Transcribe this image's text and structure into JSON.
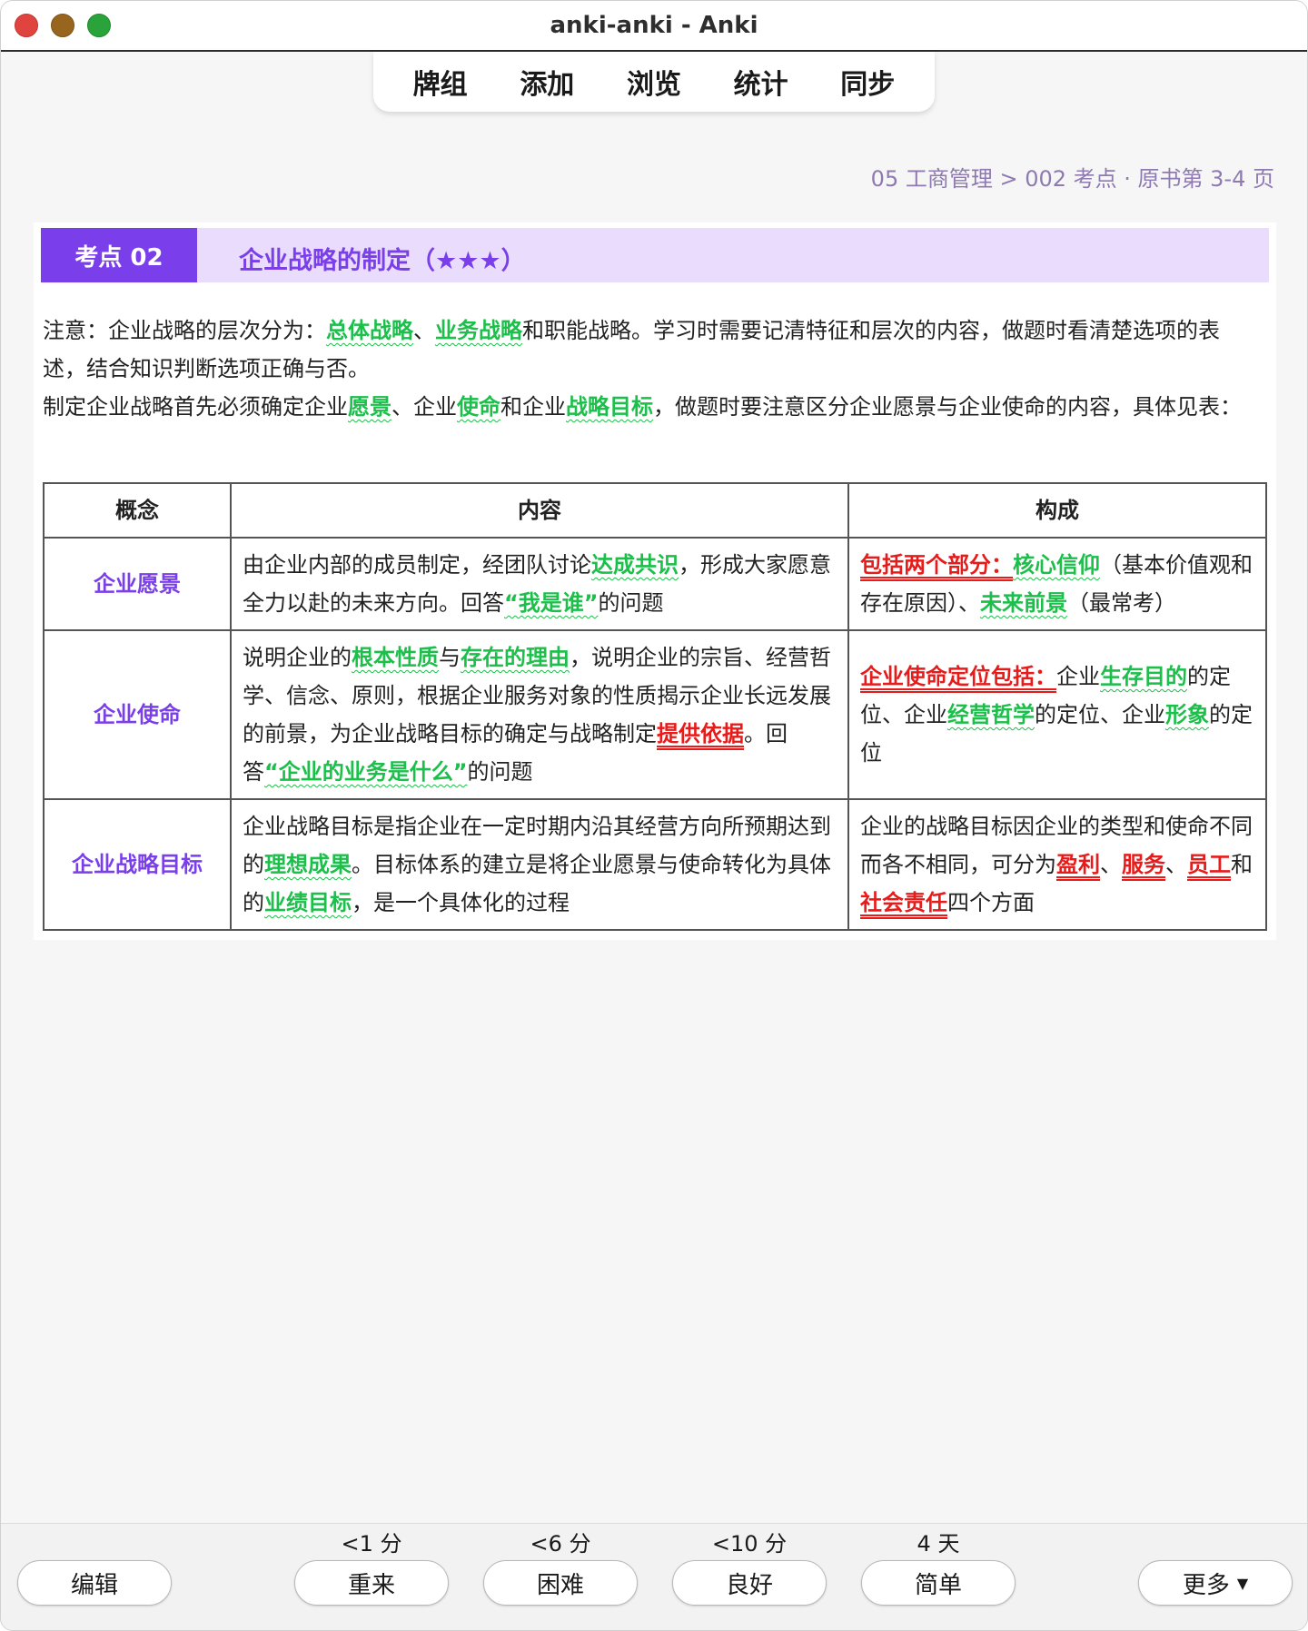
{
  "window": {
    "title": "anki-anki - Anki"
  },
  "toolbar": {
    "items": [
      "牌组",
      "添加",
      "浏览",
      "统计",
      "同步"
    ]
  },
  "breadcrumb": "05 工商管理 > 002 考点 · 原书第 3-4 页",
  "card": {
    "badge": "考点  02",
    "heading": "企业战略的制定（★★★）",
    "para1": {
      "t1": "注意：企业战略的层次分为：",
      "h1": "总体战略",
      "t2": "、",
      "h2": "业务战略",
      "t3": "和职能战略。学习时需要记清特征和层次的内容，做题时看清楚选项的表述，结合知识判断选项正确与否。"
    },
    "para2": {
      "t1": "制定企业战略首先必须确定企业",
      "h1": "愿景",
      "t2": "、企业",
      "h2": "使命",
      "t3": "和企业",
      "h3": "战略目标",
      "t4": "，做题时要注意区分企业愿景与企业使命的内容，具体见表："
    },
    "table": {
      "headers": [
        "概念",
        "内容",
        "构成"
      ],
      "rows": [
        {
          "term": "企业愿景",
          "content": {
            "t1": "由企业内部的成员制定，经团队讨论",
            "h1": "达成共识",
            "t2": "，形成大家愿意全力以赴的未来方向。回答",
            "h2": "“我是谁”",
            "t3": "的问题"
          },
          "comp": {
            "r1": "包括两个部分：",
            "h1": "核心信仰",
            "t1": "（基本价值观和存在原因）、",
            "h2": "未来前景",
            "t2": "（最常考）"
          }
        },
        {
          "term": "企业使命",
          "content": {
            "t1": "说明企业的",
            "h1": "根本性质",
            "t2": "与",
            "h2": "存在的理由",
            "t3": "，说明企业的宗旨、经营哲学、信念、原则，根据企业服务对象的性质揭示企业长远发展的前景，为企业战略目标的确定与战略制定",
            "r1": "提供依据",
            "t4": "。回答",
            "h3": "“企业的业务是什么”",
            "t5": "的问题"
          },
          "comp": {
            "r1": "企业使命定位包括：",
            "t1": "企业",
            "h1": "生存目的",
            "t2": "的定位、企业",
            "h2": "经营哲学",
            "t3": "的定位、企业",
            "h3": "形象",
            "t4": "的定位"
          }
        },
        {
          "term": "企业战略目标",
          "content": {
            "t1": "企业战略目标是指企业在一定时期内沿其经营方向所预期达到的",
            "h1": "理想成果",
            "t2": "。目标体系的建立是将企业愿景与使命转化为具体的",
            "h2": "业绩目标",
            "t3": "，是一个具体化的过程"
          },
          "comp": {
            "t1": "企业的战略目标因企业的类型和使命不同而各不相同，可分为",
            "r1": "盈利",
            "t2": "、",
            "r2": "服务",
            "t3": "、",
            "r3": "员工",
            "t4": "和",
            "r4": "社会责任",
            "t5": "四个方面"
          }
        }
      ]
    }
  },
  "bottom": {
    "edit": "编辑",
    "more": "更多",
    "answers": [
      {
        "label": "重来",
        "time": "<1 分"
      },
      {
        "label": "困难",
        "time": "<6 分"
      },
      {
        "label": "良好",
        "time": "<10 分"
      },
      {
        "label": "简单",
        "time": "4 天"
      }
    ]
  }
}
